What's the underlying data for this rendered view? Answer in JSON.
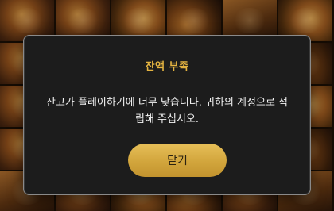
{
  "modal": {
    "title": "잔액 부족",
    "message": "잔고가 플레이하기에 너무 낮습니다. 귀하의 계정으로 적립해 주십시오.",
    "close_label": "닫기"
  },
  "colors": {
    "title_accent": "#e3b341",
    "button_gold": "#d2a53c",
    "modal_bg": "#1c1c1c",
    "modal_border": "#8a8a8a"
  }
}
